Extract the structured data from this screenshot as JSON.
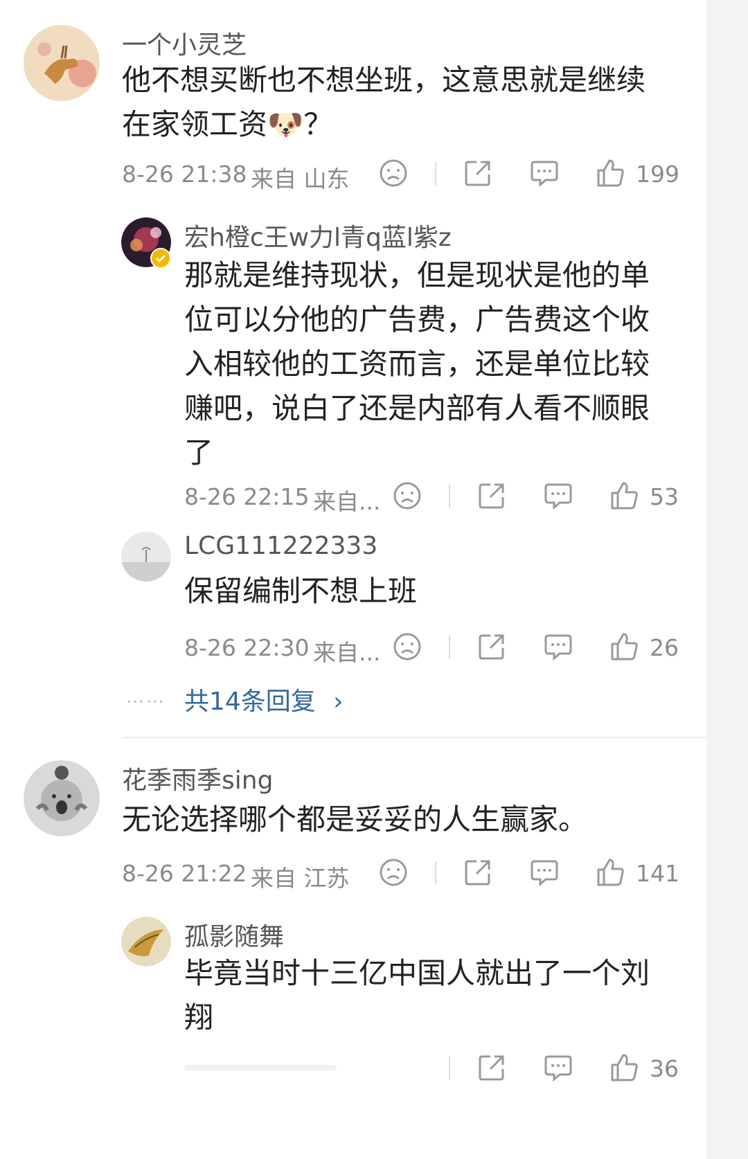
{
  "comments": [
    {
      "username": "一个小灵芝",
      "text_lines": [
        "他不想买断也不想坐班，这意思就是继续",
        "在家领工资🐶？"
      ],
      "time": "8-26 21:38",
      "location": "来自 山东",
      "likes": "199",
      "avatar": "deer-painting-avatar"
    },
    {
      "username": "花季雨季sing",
      "text_lines": [
        "无论选择哪个都是妥妥的人生赢家。"
      ],
      "time": "8-26 21:22",
      "location": "来自 江苏",
      "likes": "141",
      "avatar": "child-photo-avatar"
    }
  ],
  "replies": [
    {
      "username": "宏h橙c王w力l青q蓝l紫z",
      "text_lines": [
        "那就是维持现状，但是现状是他的单",
        "位可以分他的广告费，广告费这个收",
        "入相较他的工资而言，还是单位比较",
        "赚吧，说白了还是内部有人看不顺眼",
        "了"
      ],
      "time": "8-26 22:15",
      "location": "来自...",
      "likes": "53",
      "avatar": "fireworks-avatar",
      "verified": true
    },
    {
      "username": "LCG111222333",
      "text_lines": [
        "保留编制不想上班"
      ],
      "time": "8-26 22:30",
      "location": "来自...",
      "likes": "26",
      "avatar": "sky-avatar"
    },
    {
      "username": "孤影随舞",
      "text_lines": [
        "毕竟当时十三亿中国人就出了一个刘",
        "翔"
      ],
      "time": "",
      "location": "",
      "likes": "36",
      "avatar": "golden-bird-avatar"
    }
  ],
  "more_replies": {
    "label": "共14条回复",
    "arrow": "›",
    "dots": "……"
  },
  "icons": {
    "dislike": "dislike-face-icon",
    "share": "share-icon",
    "comment": "comment-icon",
    "like": "thumbs-up-icon"
  },
  "colors": {
    "link": "#35689b",
    "meta": "#8a8a8a",
    "text": "#222222"
  }
}
